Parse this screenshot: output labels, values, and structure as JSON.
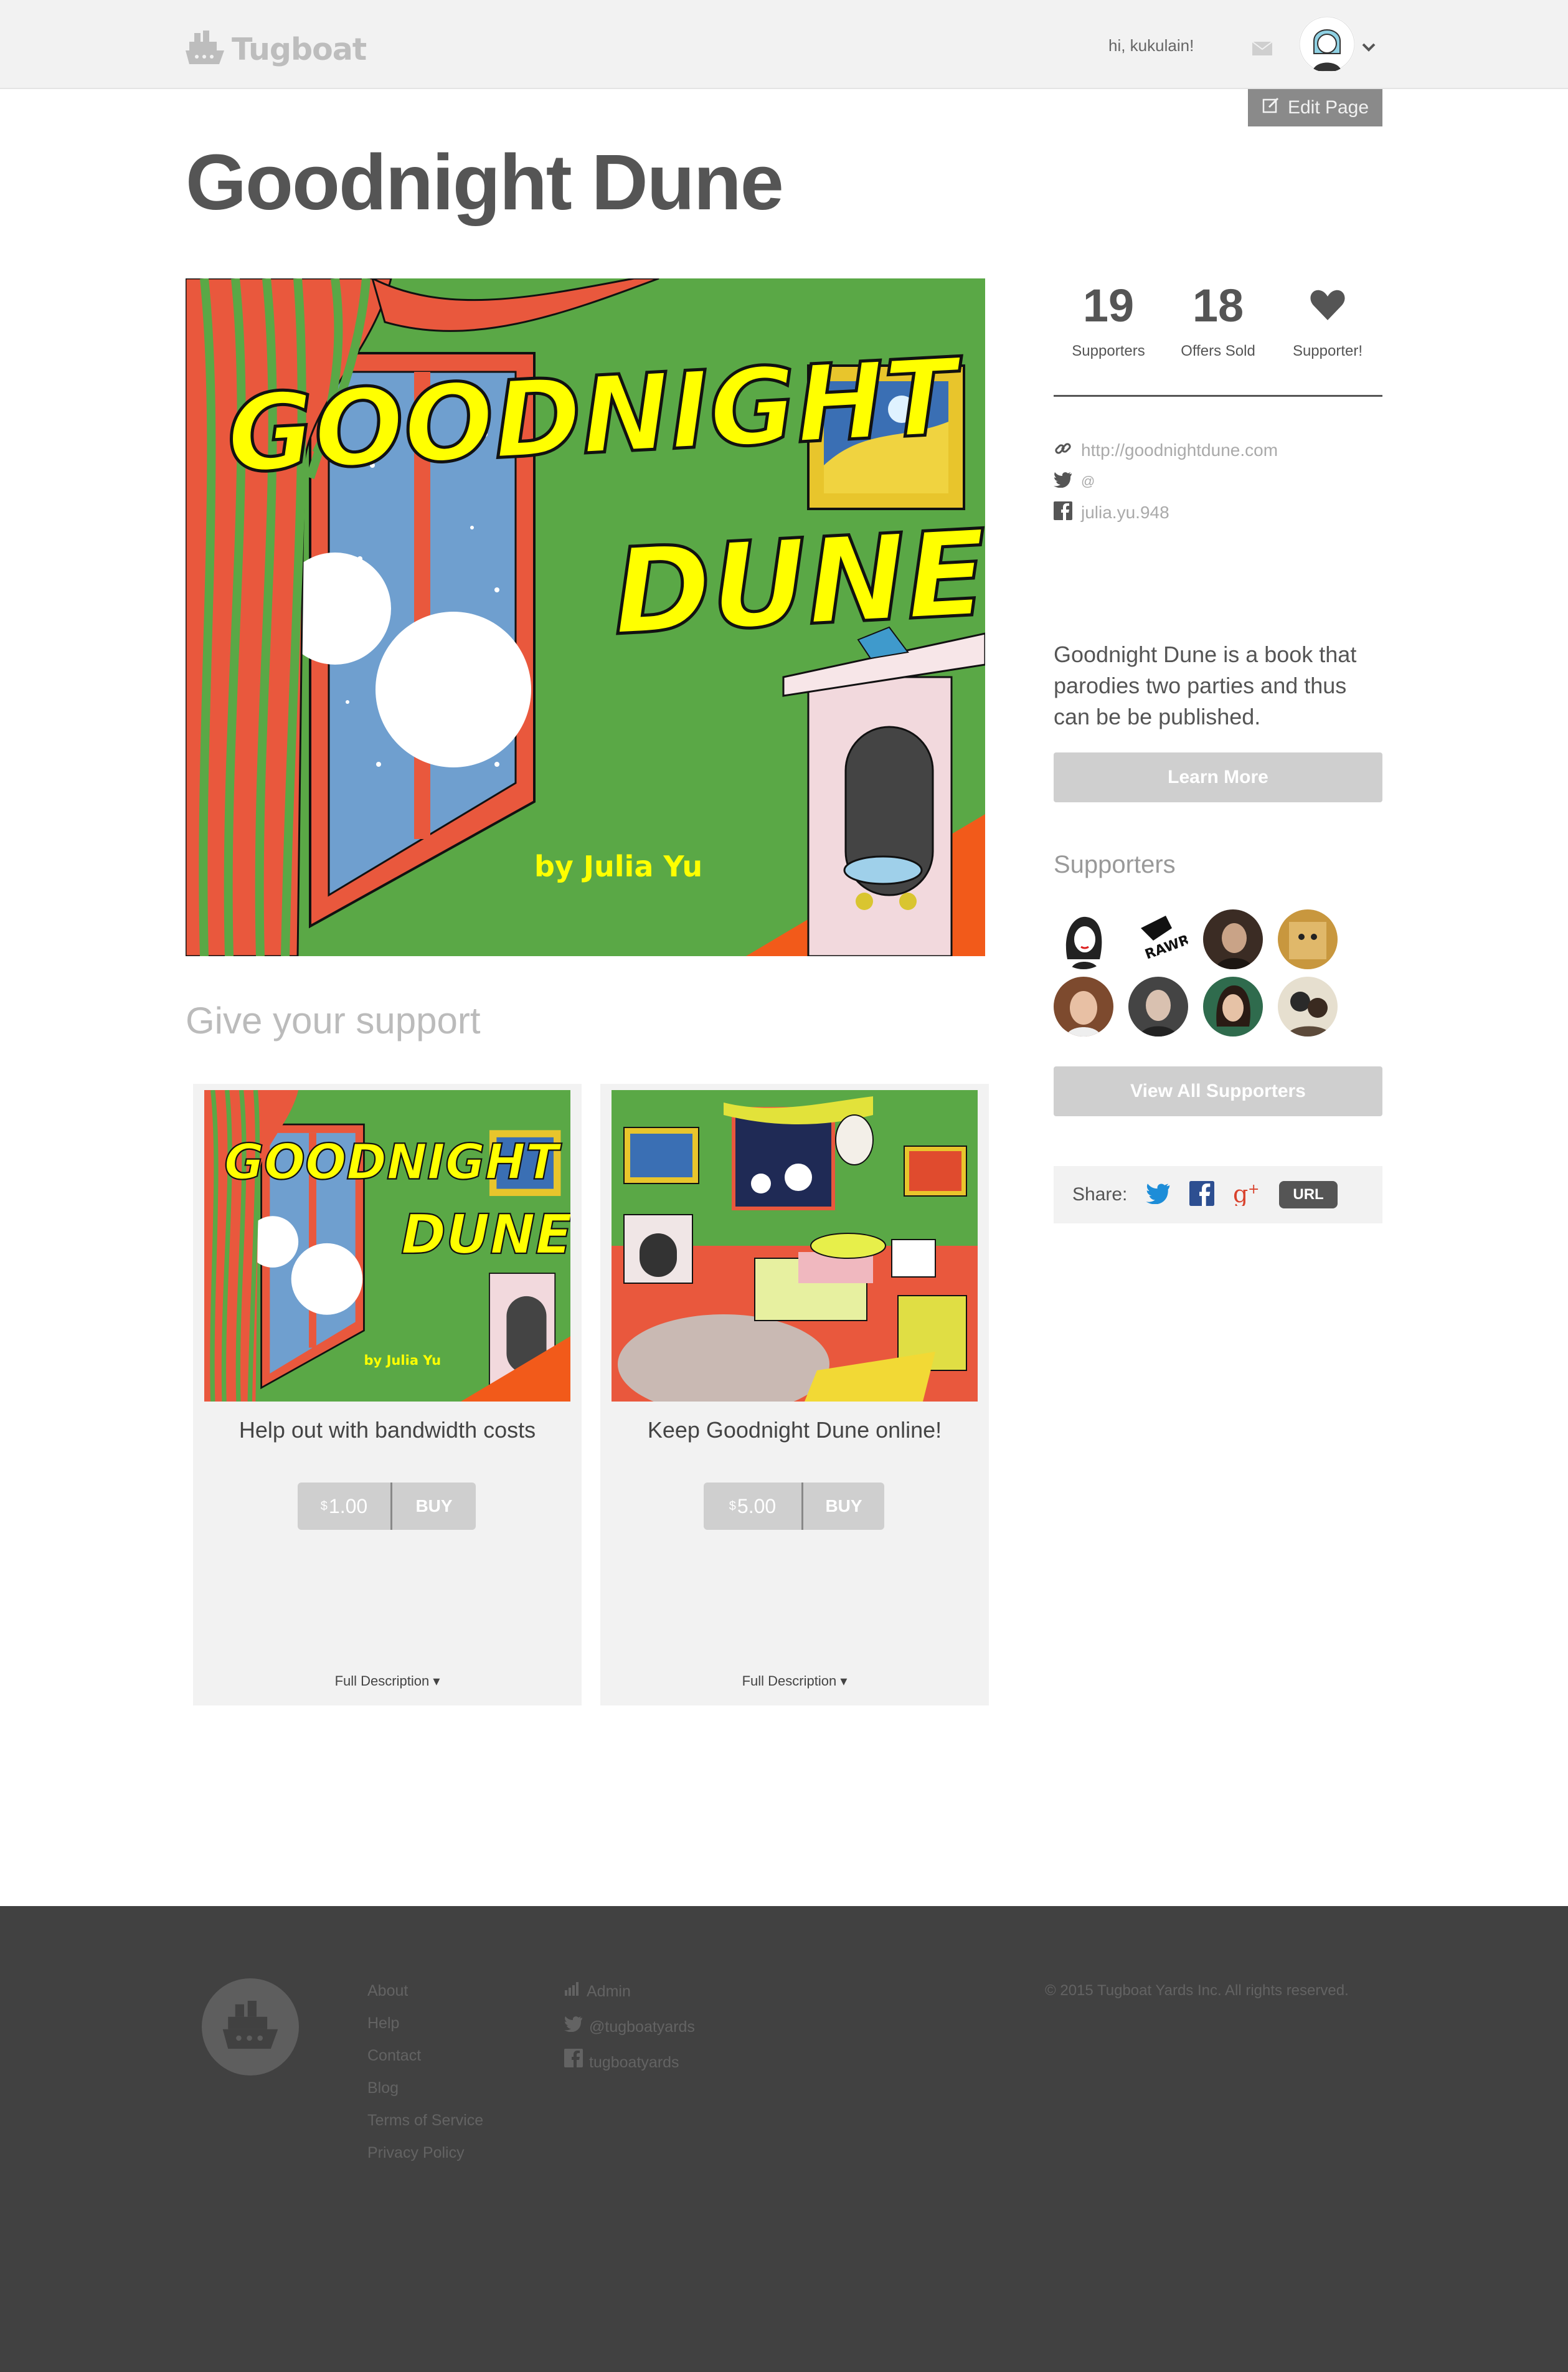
{
  "header": {
    "brand": "Tugboat",
    "greeting": "hi, kukulain!",
    "edit_label": "Edit Page"
  },
  "page": {
    "title": "Goodnight Dune",
    "hero": {
      "title_line1": "GOODNIGHT",
      "title_line2": "DUNE",
      "byline": "by Julia Yu"
    }
  },
  "stats": [
    {
      "value": "19",
      "label": "Supporters"
    },
    {
      "value": "18",
      "label": "Offers Sold"
    },
    {
      "value": "",
      "label": "Supporter!"
    }
  ],
  "links": {
    "website": "http://goodnightdune.com",
    "twitter": "@",
    "facebook": "julia.yu.948"
  },
  "description": "Goodnight Dune is a book that parodies two parties and thus can be be published.",
  "learn_more": "Learn More",
  "supporters": {
    "title": "Supporters",
    "view_all": "View All Supporters",
    "rawr_text": "RAWR"
  },
  "share": {
    "label": "Share:",
    "url": "URL"
  },
  "give": {
    "title": "Give your support",
    "offers": [
      {
        "title": "Help out with bandwidth costs",
        "currency": "$",
        "price": "1.00",
        "buy": "BUY",
        "full_desc": "Full Description",
        "img_title1": "GOODNIGHT",
        "img_title2": "DUNE",
        "img_byline": "by Julia Yu"
      },
      {
        "title": "Keep Goodnight Dune online!",
        "currency": "$",
        "price": "5.00",
        "buy": "BUY",
        "full_desc": "Full Description"
      }
    ]
  },
  "footer": {
    "links": [
      "About",
      "Help",
      "Contact",
      "Blog",
      "Terms of Service",
      "Privacy Policy"
    ],
    "admin": "Admin",
    "twitter": "@tugboatyards",
    "facebook": "tugboatyards",
    "copyright": "© 2015 Tugboat Yards Inc. All rights reserved."
  },
  "colors": {
    "hero_green": "#5aa846",
    "title_yellow": "#ffff00",
    "curtain_red": "#e9583d",
    "footer_bg": "#414141",
    "button_grey": "#cfcfcf"
  },
  "icons": [
    "tugboat-logo-icon",
    "mail-icon",
    "chevron-down-icon",
    "edit-icon",
    "heart-icon",
    "link-icon",
    "twitter-icon",
    "facebook-icon",
    "google-plus-icon",
    "bars-icon"
  ]
}
